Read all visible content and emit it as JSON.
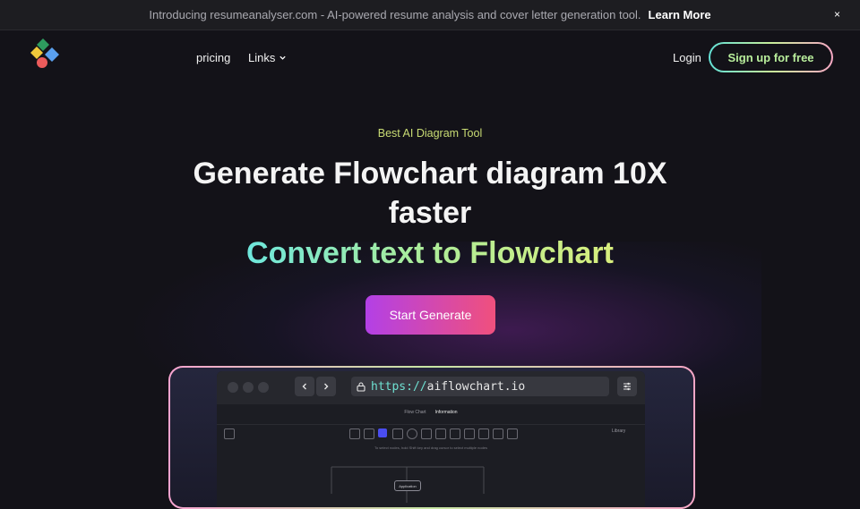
{
  "banner": {
    "text": "Introducing resumeanalyser.com - AI-powered resume analysis and cover letter generation tool.",
    "link": "Learn More",
    "close": "×"
  },
  "nav": {
    "pricing": "pricing",
    "links": "Links",
    "login": "Login",
    "signup": "Sign up for free"
  },
  "hero": {
    "eyebrow": "Best AI Diagram Tool",
    "headline": "Generate Flowchart diagram 10X faster",
    "subhead": "Convert text to Flowchart",
    "cta": "Start Generate"
  },
  "preview": {
    "url_scheme": "https://",
    "url_host": "aiflowchart.io",
    "tabs": [
      "Flow Chart",
      "Information"
    ],
    "selection": "Library",
    "hint": "To select nodes, hold Shift key and drag cursor to select multiple nodes",
    "node": "Application"
  },
  "colors": {
    "background": "#131218",
    "eyebrow": "#c9dc74",
    "cta_start": "#b340e6",
    "cta_end": "#f0507d",
    "accent_teal": "#6ee7dd",
    "accent_lime": "#d8ee7d"
  },
  "icons": [
    "logo-diamond-icon",
    "chevron-down-icon",
    "close-icon",
    "chevron-left-icon",
    "chevron-right-icon",
    "lock-icon",
    "sliders-icon"
  ]
}
